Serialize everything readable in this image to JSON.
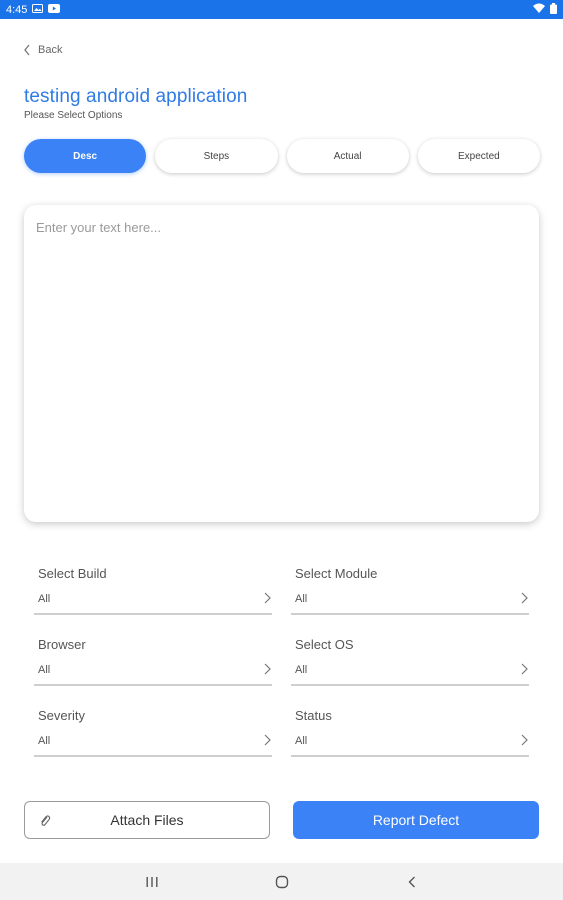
{
  "status_bar": {
    "time": "4:45",
    "left_icons": [
      "image-icon",
      "youtube-icon"
    ],
    "right_icons": [
      "wifi-icon",
      "battery-icon"
    ],
    "color": "#1a73e8"
  },
  "header": {
    "back_label": "Back",
    "title": "testing android application",
    "subtitle": "Please Select Options"
  },
  "tabs": [
    {
      "label": "Desc",
      "active": true
    },
    {
      "label": "Steps",
      "active": false
    },
    {
      "label": "Actual",
      "active": false
    },
    {
      "label": "Expected",
      "active": false
    }
  ],
  "text_area": {
    "placeholder": "Enter your text here...",
    "value": ""
  },
  "fields": [
    {
      "label": "Select Build",
      "value": "All"
    },
    {
      "label": "Select Module",
      "value": "All"
    },
    {
      "label": "Browser",
      "value": "All"
    },
    {
      "label": "Select OS",
      "value": "All"
    },
    {
      "label": "Severity",
      "value": "All"
    },
    {
      "label": "Status",
      "value": "All"
    }
  ],
  "actions": {
    "attach_label": "Attach Files",
    "report_label": "Report Defect"
  },
  "nav_bar": {
    "icons": [
      "recents-icon",
      "home-icon",
      "back-icon"
    ]
  },
  "colors": {
    "accent": "#3b82f6",
    "title": "#2f7be6"
  }
}
